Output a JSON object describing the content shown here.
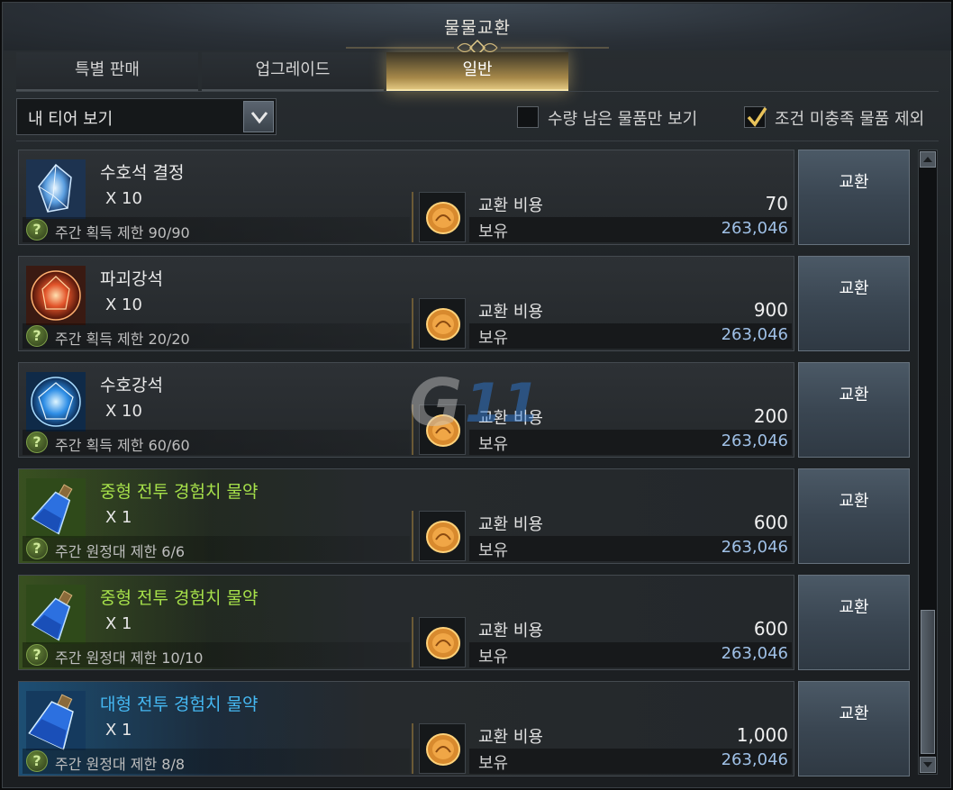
{
  "window": {
    "title": "물물교환"
  },
  "tabs": [
    {
      "label": "특별 판매",
      "active": false
    },
    {
      "label": "업그레이드",
      "active": false
    },
    {
      "label": "일반",
      "active": true
    }
  ],
  "filter": {
    "dropdown_value": "내 티어 보기",
    "checkbox_remaining": {
      "label": "수량 남은 물품만 보기",
      "checked": false
    },
    "checkbox_exclude": {
      "label": "조건 미충족 물품 제외",
      "checked": true
    }
  },
  "items": [
    {
      "name": "수호석 결정",
      "qty": "X 10",
      "limit": "주간 획득 제한 90/90",
      "cost_label": "교환 비용",
      "cost": "70",
      "own_label": "보유",
      "own": "263,046",
      "button": "교환",
      "icon": "guardian-crystal-icon",
      "grade_color": "white"
    },
    {
      "name": "파괴강석",
      "qty": "X 10",
      "limit": "주간 획득 제한 20/20",
      "cost_label": "교환 비용",
      "cost": "900",
      "own_label": "보유",
      "own": "263,046",
      "button": "교환",
      "icon": "destruction-stone-icon",
      "grade_color": "white"
    },
    {
      "name": "수호강석",
      "qty": "X 10",
      "limit": "주간 획득 제한 60/60",
      "cost_label": "교환 비용",
      "cost": "200",
      "own_label": "보유",
      "own": "263,046",
      "button": "교환",
      "icon": "guardian-stone-icon",
      "grade_color": "white"
    },
    {
      "name": "중형 전투 경험치 물약",
      "qty": "X 1",
      "limit": "주간 원정대 제한 6/6",
      "cost_label": "교환 비용",
      "cost": "600",
      "own_label": "보유",
      "own": "263,046",
      "button": "교환",
      "icon": "potion-icon",
      "grade_color": "green"
    },
    {
      "name": "중형 전투 경험치 물약",
      "qty": "X 1",
      "limit": "주간 원정대 제한 10/10",
      "cost_label": "교환 비용",
      "cost": "600",
      "own_label": "보유",
      "own": "263,046",
      "button": "교환",
      "icon": "potion-icon",
      "grade_color": "green"
    },
    {
      "name": "대형 전투 경험치 물약",
      "qty": "X 1",
      "limit": "주간 원정대 제한 8/8",
      "cost_label": "교환 비용",
      "cost": "1,000",
      "own_label": "보유",
      "own": "263,046",
      "button": "교환",
      "icon": "large-potion-icon",
      "grade_color": "blue"
    }
  ],
  "watermark": "G11",
  "colors": {
    "accent_gold": "#e0c57f",
    "grade_green": "#a6e04a",
    "grade_blue": "#45b8f2",
    "own_value": "#9fc0e6"
  }
}
